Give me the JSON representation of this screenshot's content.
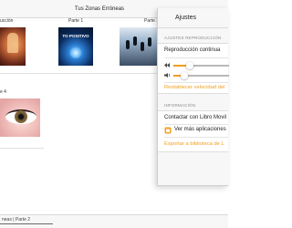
{
  "window": {
    "title": "Tus Zonas Erróneas"
  },
  "chapters": [
    {
      "label": "ucción",
      "thumb": "silhouette-meditation-image"
    },
    {
      "label": "Parte 1",
      "thumb": "to-positivo-image",
      "thumb_text": "TO POSITIVO"
    },
    {
      "label": "Parte 2",
      "thumb": "jumping-people-image"
    },
    {
      "label": "e 4",
      "thumb": "eye-closeup-image"
    }
  ],
  "settings": {
    "title": "Ajustes",
    "playback": {
      "header": "AJUSTES REPRODUCCIÓN",
      "continuous_label": "Reproducción continua",
      "speed_level": 0.3,
      "volume_level": 0.2,
      "reset_label": "Restablecer velocidad del"
    },
    "info": {
      "header": "INFORMACIÓN",
      "contact_label": "Contactar con Libro Movil",
      "more_apps_label": "Ver más aplicaciones",
      "export_label": "Exportar a biblioteca de L"
    },
    "accent_color": "#f0a020"
  },
  "footer": {
    "breadcrumb": "neas | Parte 2"
  }
}
